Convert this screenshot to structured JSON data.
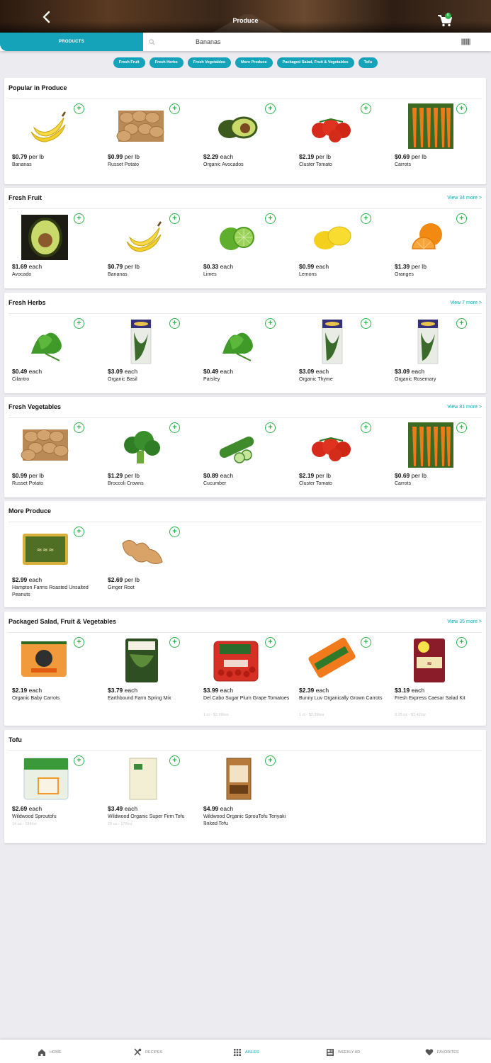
{
  "header": {
    "title": "Produce",
    "cart_count": "0"
  },
  "search": {
    "tab_label": "PRODUCTS",
    "value": "Bananas"
  },
  "chips": [
    "Fresh Fruit",
    "Fresh Herbs",
    "Fresh Vegetables",
    "More Produce",
    "Packaged Salad, Fruit & Vegetables",
    "Tofu"
  ],
  "sections": [
    {
      "title": "Popular in Produce",
      "view_more": "",
      "items": [
        {
          "price": "$0.79",
          "unit": "per lb",
          "name": "Bananas",
          "sub": "",
          "icon": "banana"
        },
        {
          "price": "$0.99",
          "unit": "per lb",
          "name": "Russet Potato",
          "sub": "",
          "icon": "potato"
        },
        {
          "price": "$2.29",
          "unit": "each",
          "name": "Organic Avocados",
          "sub": "",
          "icon": "avocado"
        },
        {
          "price": "$2.19",
          "unit": "per lb",
          "name": "Cluster Tomato",
          "sub": "",
          "icon": "tomato"
        },
        {
          "price": "$0.69",
          "unit": "per lb",
          "name": "Carrots",
          "sub": "",
          "icon": "carrots"
        }
      ]
    },
    {
      "title": "Fresh Fruit",
      "view_more": "View 34 more >",
      "items": [
        {
          "price": "$1.69",
          "unit": "each",
          "name": "Avocado",
          "sub": "",
          "icon": "avocado-dark"
        },
        {
          "price": "$0.79",
          "unit": "per lb",
          "name": "Bananas",
          "sub": "",
          "icon": "banana"
        },
        {
          "price": "$0.33",
          "unit": "each",
          "name": "Limes",
          "sub": "",
          "icon": "lime"
        },
        {
          "price": "$0.99",
          "unit": "each",
          "name": "Lemons",
          "sub": "",
          "icon": "lemon"
        },
        {
          "price": "$1.39",
          "unit": "per lb",
          "name": "Oranges",
          "sub": "",
          "icon": "orange"
        }
      ]
    },
    {
      "title": "Fresh Herbs",
      "view_more": "View 7 more >",
      "items": [
        {
          "price": "$0.49",
          "unit": "each",
          "name": "Cilantro",
          "sub": "",
          "icon": "herb"
        },
        {
          "price": "$3.09",
          "unit": "each",
          "name": "Organic Basil",
          "sub": "",
          "icon": "herb-pack"
        },
        {
          "price": "$0.49",
          "unit": "each",
          "name": "Parsley",
          "sub": "",
          "icon": "herb"
        },
        {
          "price": "$3.09",
          "unit": "each",
          "name": "Organic Thyme",
          "sub": "",
          "icon": "herb-pack"
        },
        {
          "price": "$3.09",
          "unit": "each",
          "name": "Organic Rosemary",
          "sub": "",
          "icon": "herb-pack"
        }
      ]
    },
    {
      "title": "Fresh Vegetables",
      "view_more": "View 81 more >",
      "items": [
        {
          "price": "$0.99",
          "unit": "per lb",
          "name": "Russet Potato",
          "sub": "",
          "icon": "potato"
        },
        {
          "price": "$1.29",
          "unit": "per lb",
          "name": "Broccoli Crowns",
          "sub": "",
          "icon": "broccoli"
        },
        {
          "price": "$0.89",
          "unit": "each",
          "name": "Cucumber",
          "sub": "",
          "icon": "cucumber"
        },
        {
          "price": "$2.19",
          "unit": "per lb",
          "name": "Cluster Tomato",
          "sub": "",
          "icon": "tomato"
        },
        {
          "price": "$0.69",
          "unit": "per lb",
          "name": "Carrots",
          "sub": "",
          "icon": "carrots"
        }
      ]
    },
    {
      "title": "More Produce",
      "view_more": "",
      "items": [
        {
          "price": "$2.99",
          "unit": "each",
          "name": "Hampton Farms Roasted Unsalted Peanuts",
          "sub": "",
          "icon": "peanuts"
        },
        {
          "price": "$2.69",
          "unit": "per lb",
          "name": "Ginger Root",
          "sub": "",
          "icon": "ginger"
        }
      ]
    },
    {
      "title": "Packaged Salad, Fruit & Vegetables",
      "view_more": "View 35 more >",
      "items": [
        {
          "price": "$2.19",
          "unit": "each",
          "name": "Organic Baby Carrots",
          "sub": "",
          "icon": "carrot-bag"
        },
        {
          "price": "$3.79",
          "unit": "each",
          "name": "Earthbound Farm Spring Mix",
          "sub": "",
          "icon": "salad-box"
        },
        {
          "price": "$3.99",
          "unit": "each",
          "name": "Del Cabo Sugar Plum Grape Tomatoes",
          "sub": "1 ct - $3.99/ea",
          "icon": "tomato-pack"
        },
        {
          "price": "$2.39",
          "unit": "each",
          "name": "Bunny Luv Organically Grown Carrots",
          "sub": "1 ct - $2.39/ea",
          "icon": "carrot-bag2"
        },
        {
          "price": "$3.19",
          "unit": "each",
          "name": "Fresh Express Caesar Salad Kit",
          "sub": "3.25 oz - $1.42/oz",
          "icon": "caesar-kit"
        }
      ]
    },
    {
      "title": "Tofu",
      "view_more": "",
      "items": [
        {
          "price": "$2.69",
          "unit": "each",
          "name": "Wildwood Sproutofu",
          "sub": "14 oz - 19¢/oz",
          "icon": "tofu-pack"
        },
        {
          "price": "$3.49",
          "unit": "each",
          "name": "Wildwood Organic Super Firm Tofu",
          "sub": "20 oz - 17¢/oz",
          "icon": "tofu-block"
        },
        {
          "price": "$4.99",
          "unit": "each",
          "name": "Wildwood Organic SprouTofu Teriyaki Baked Tofu",
          "sub": "6 oz - 83¢/oz",
          "icon": "tofu-baked"
        }
      ]
    }
  ],
  "nav": [
    {
      "label": "HOME",
      "icon": "home-icon"
    },
    {
      "label": "RECIPES",
      "icon": "utensils-icon"
    },
    {
      "label": "AISLES",
      "icon": "grid-icon"
    },
    {
      "label": "WEEKLY AD",
      "icon": "newspaper-icon"
    },
    {
      "label": "FAVORITES",
      "icon": "heart-icon"
    }
  ],
  "colors": {
    "accent": "#14a3b8",
    "add_green": "#2db34a"
  }
}
